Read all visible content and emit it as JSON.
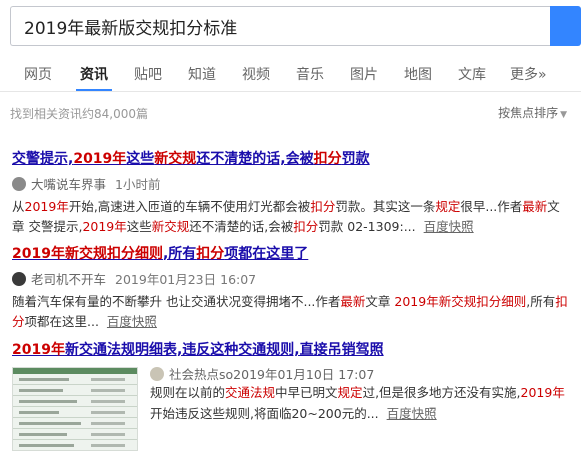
{
  "search": {
    "query": "2019年最新版交规扣分标准"
  },
  "tabs": [
    {
      "label": "网页"
    },
    {
      "label": "资讯"
    },
    {
      "label": "贴吧"
    },
    {
      "label": "知道"
    },
    {
      "label": "视频"
    },
    {
      "label": "音乐"
    },
    {
      "label": "图片"
    },
    {
      "label": "地图"
    },
    {
      "label": "文库"
    },
    {
      "label": "更多»"
    }
  ],
  "result_count": "找到相关资讯约84,000篇",
  "sort_label": "按焦点排序",
  "colors": {
    "title": "#1a0dab",
    "highlight": "#cc0000",
    "accent": "#3385ff"
  },
  "results": [
    {
      "title": [
        {
          "t": "交警提示,",
          "hl": false
        },
        {
          "t": "2019年",
          "hl": true
        },
        {
          "t": "这些",
          "hl": false
        },
        {
          "t": "新交规",
          "hl": true
        },
        {
          "t": "还不清楚的话,会被",
          "hl": false
        },
        {
          "t": "扣分",
          "hl": true
        },
        {
          "t": "罚款",
          "hl": false
        }
      ],
      "source": "大嘴说车界事",
      "time": "1小时前",
      "abstract": [
        {
          "t": "从",
          "hl": false
        },
        {
          "t": "2019年",
          "hl": true
        },
        {
          "t": "开始,高速进入匝道的车辆不使用灯光都会被",
          "hl": false
        },
        {
          "t": "扣分",
          "hl": true
        },
        {
          "t": "罚款。其实这一条",
          "hl": false
        },
        {
          "t": "规定",
          "hl": true
        },
        {
          "t": "很早...作者",
          "hl": false
        },
        {
          "t": "最新",
          "hl": true
        },
        {
          "t": "文章 交警提示,",
          "hl": false
        },
        {
          "t": "2019年",
          "hl": true
        },
        {
          "t": "这些",
          "hl": false
        },
        {
          "t": "新交规",
          "hl": true
        },
        {
          "t": "还不清楚的话,会被",
          "hl": false
        },
        {
          "t": "扣分",
          "hl": true
        },
        {
          "t": "罚款 02-1309:...",
          "hl": false
        }
      ],
      "snapshot": "百度快照"
    },
    {
      "title": [
        {
          "t": "2019年新交规扣分细则",
          "hl": true
        },
        {
          "t": ",所有",
          "hl": false
        },
        {
          "t": "扣分",
          "hl": true
        },
        {
          "t": "项都在这里了",
          "hl": false
        }
      ],
      "source": "老司机不开车",
      "time": "2019年01月23日 16:07",
      "abstract": [
        {
          "t": "随着汽车保有量的不断攀升 也让交通状况变得拥堵不...作者",
          "hl": false
        },
        {
          "t": "最新",
          "hl": true
        },
        {
          "t": "文章 ",
          "hl": false
        },
        {
          "t": "2019年新交规扣分细则",
          "hl": true
        },
        {
          "t": ",所有",
          "hl": false
        },
        {
          "t": "扣分",
          "hl": true
        },
        {
          "t": "项都在这里...",
          "hl": false
        }
      ],
      "snapshot": "百度快照"
    },
    {
      "title": [
        {
          "t": "2019年",
          "hl": true
        },
        {
          "t": "新交通法规明细表,违反这种交通规则,直接吊销驾照",
          "hl": false
        }
      ],
      "source": "社会热点so",
      "time": "2019年01月10日 17:07",
      "abstract": [
        {
          "t": "规则在以前的",
          "hl": false
        },
        {
          "t": "交通法规",
          "hl": true
        },
        {
          "t": "中早已明文",
          "hl": false
        },
        {
          "t": "规定",
          "hl": true
        },
        {
          "t": "过,但是很多地方还没有实施,",
          "hl": false
        },
        {
          "t": "2019年",
          "hl": true
        },
        {
          "t": "开始违反这些规则,将面临20~200元的...",
          "hl": false
        }
      ],
      "snapshot": "百度快照"
    }
  ]
}
